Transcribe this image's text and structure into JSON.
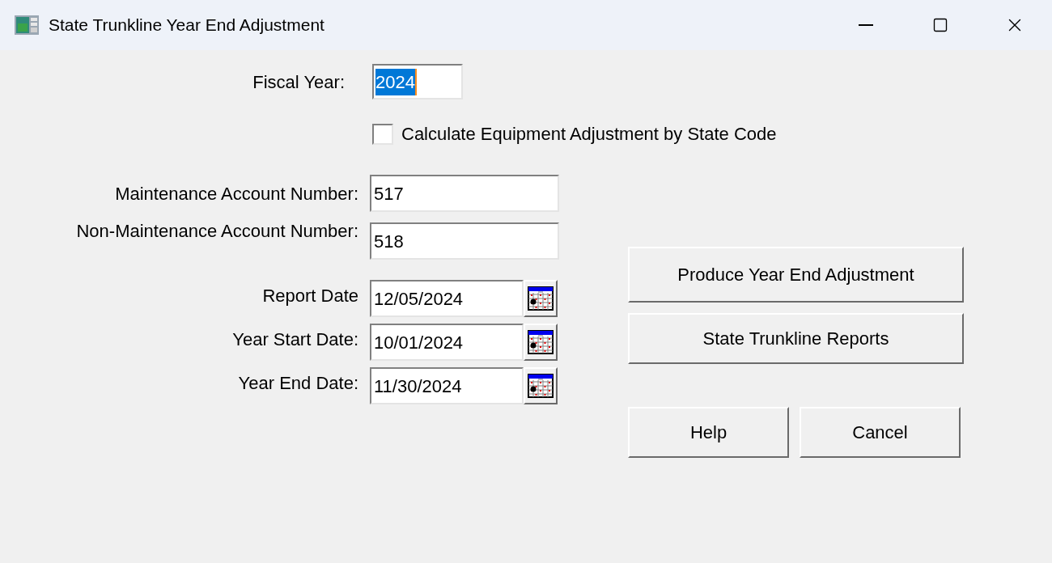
{
  "window": {
    "title": "State Trunkline Year End Adjustment"
  },
  "fiscal_year": {
    "label": "Fiscal Year:",
    "value": "2024",
    "text_selected": true
  },
  "checkbox": {
    "label": "Calculate Equipment Adjustment by State Code",
    "checked": false
  },
  "account_fields": [
    {
      "label": "Maintenance Account Number:",
      "value": "517"
    },
    {
      "label": "Non-Maintenance Account Number:",
      "value": "518"
    }
  ],
  "date_fields": [
    {
      "label": "Report Date",
      "value": "12/05/2024"
    },
    {
      "label": "Year Start Date:",
      "value": "10/01/2024"
    },
    {
      "label": "Year End Date:",
      "value": "11/30/2024"
    }
  ],
  "buttons": [
    "Produce Year End Adjustment",
    "State Trunkline Reports",
    "Help",
    "Cancel"
  ]
}
